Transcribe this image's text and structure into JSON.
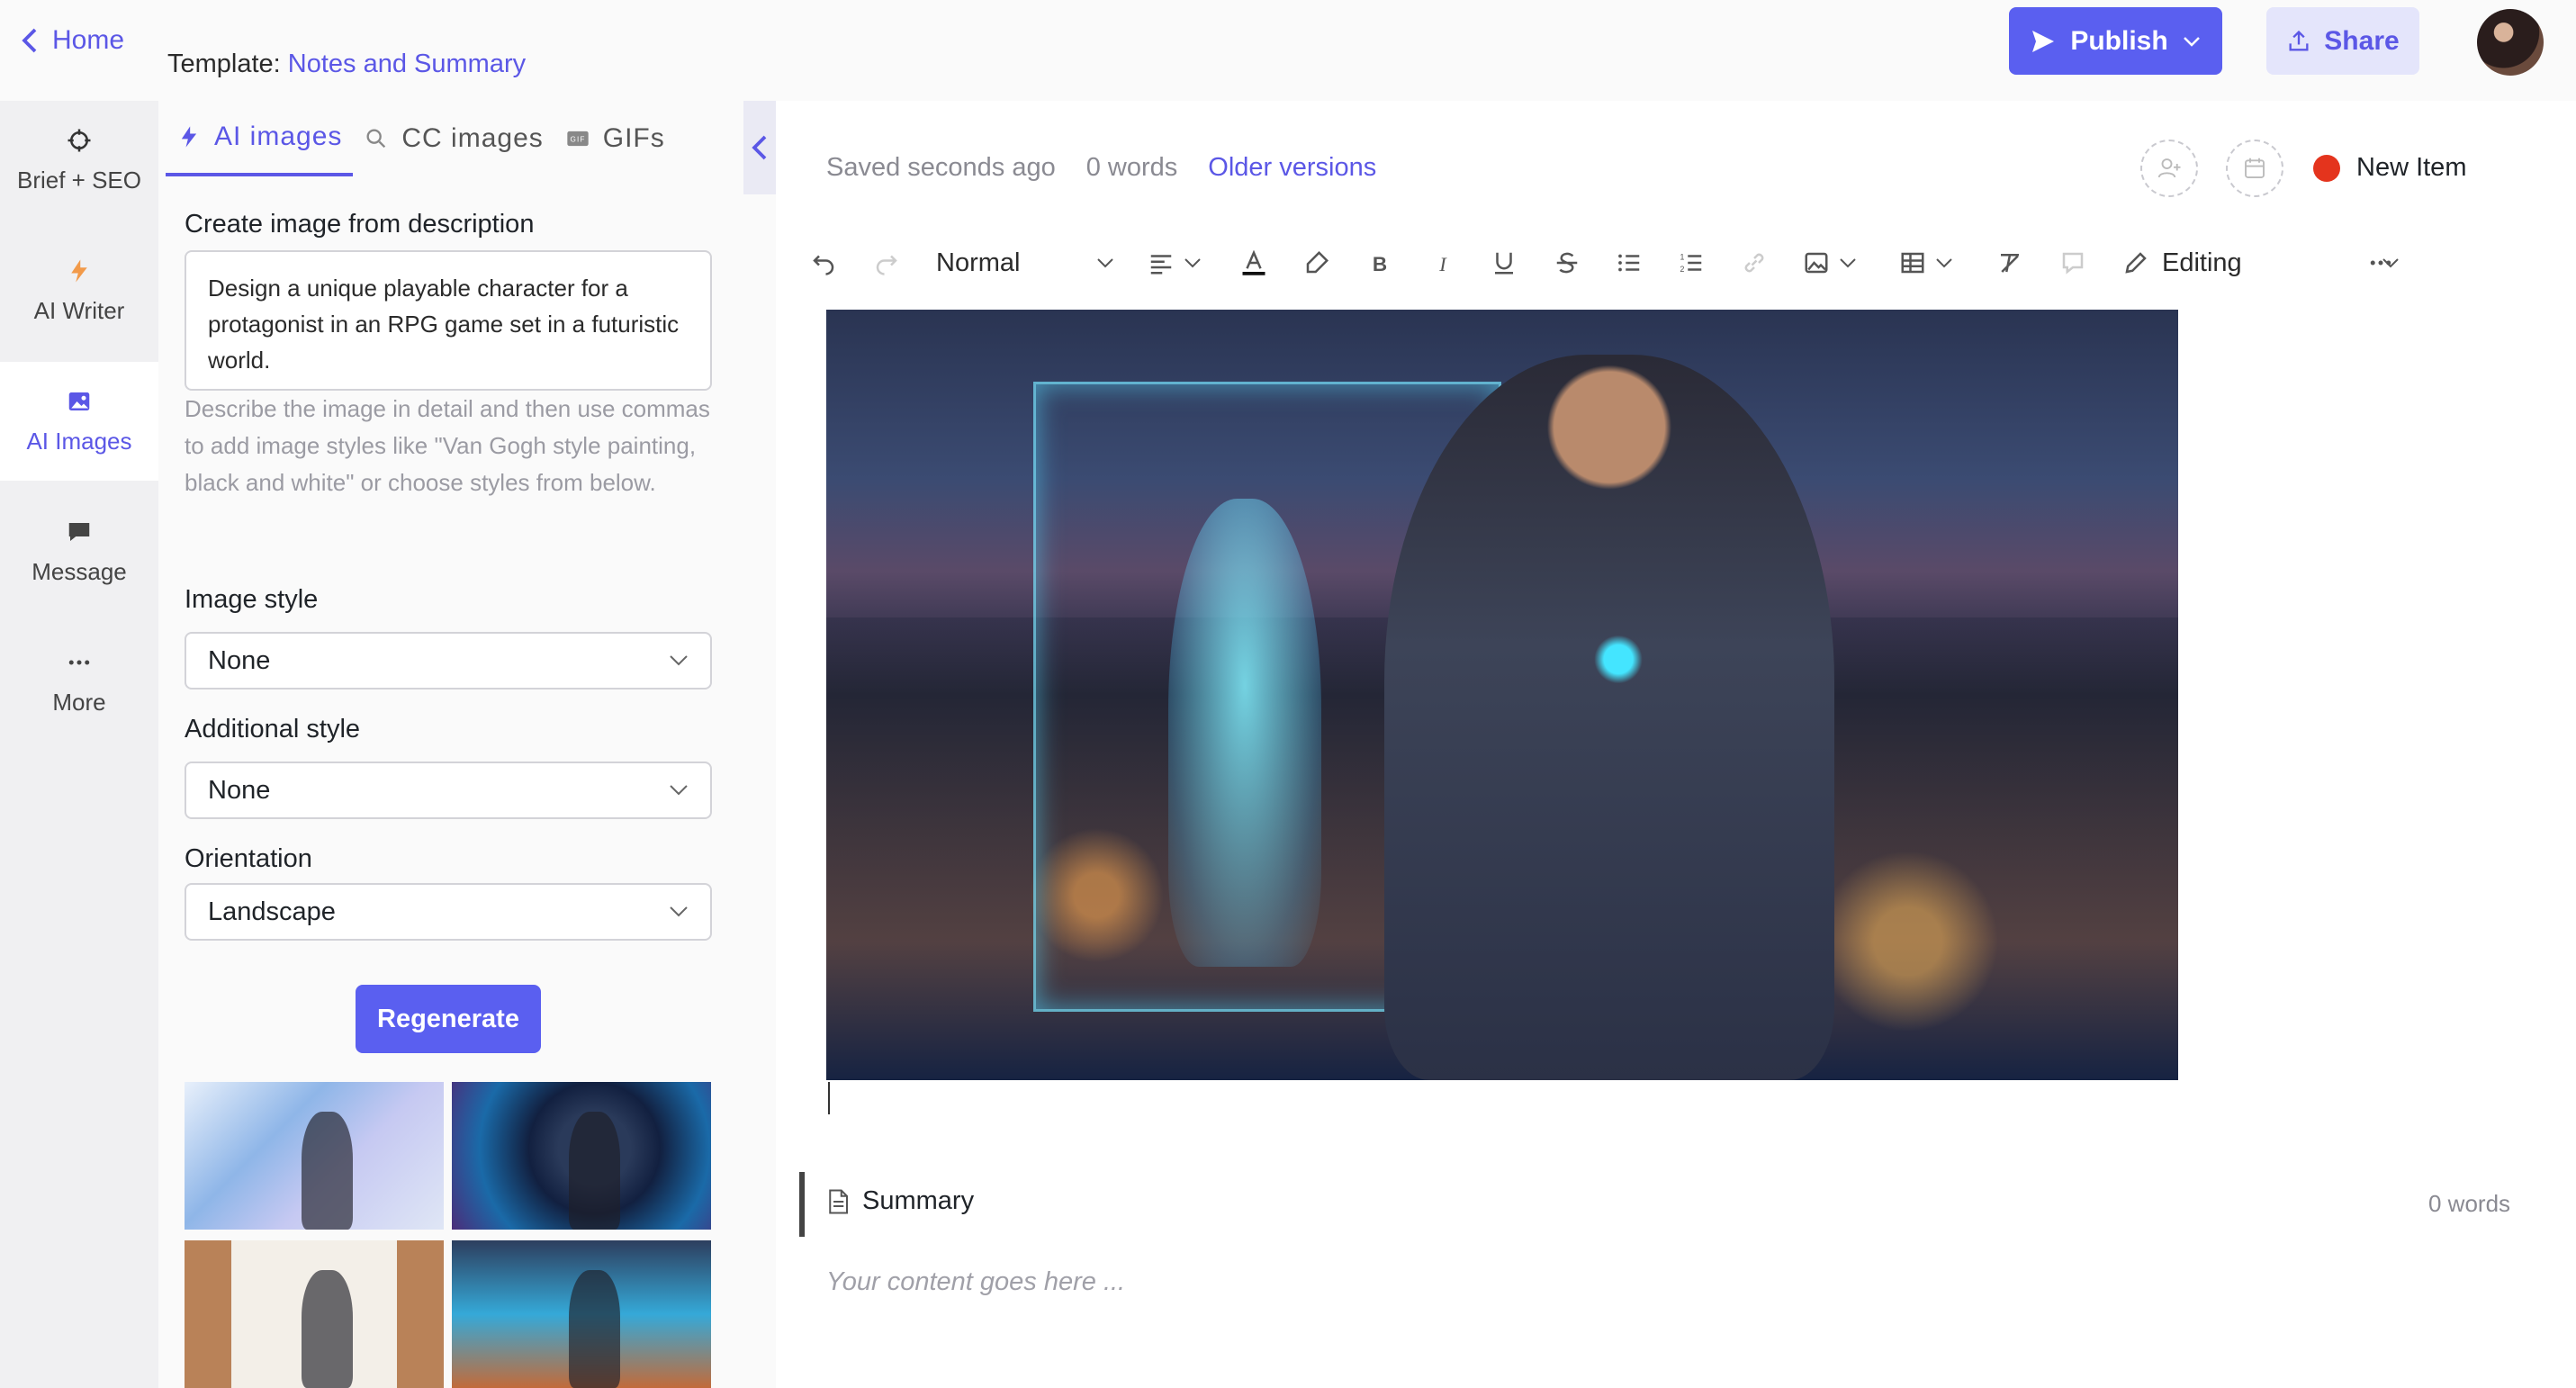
{
  "header": {
    "home_label": "Home",
    "template_prefix": "Template:",
    "template_name": "Notes and Summary",
    "publish_label": "Publish",
    "share_label": "Share"
  },
  "rail": {
    "items": [
      {
        "label": "Brief + SEO",
        "icon": "crosshair-icon"
      },
      {
        "label": "AI Writer",
        "icon": "bolt-icon"
      },
      {
        "label": "AI Images",
        "icon": "image-icon"
      },
      {
        "label": "Message",
        "icon": "chat-icon"
      },
      {
        "label": "More",
        "icon": "more-icon"
      }
    ],
    "active": "AI Images"
  },
  "panel": {
    "tabs": [
      {
        "label": "AI images",
        "icon": "bolt-icon"
      },
      {
        "label": "CC images",
        "icon": "search-icon"
      },
      {
        "label": "GIFs",
        "icon": "gif-icon"
      }
    ],
    "active_tab": "AI images",
    "description_label": "Create image from description",
    "description_value": "Design a unique playable character for a protagonist in an RPG game set in a futuristic world.",
    "hint": "Describe the image in detail and then use commas to add image styles like \"Van Gogh style painting, black and white\" or choose styles from below.",
    "image_style_label": "Image style",
    "image_style_value": "None",
    "additional_style_label": "Additional style",
    "additional_style_value": "None",
    "orientation_label": "Orientation",
    "orientation_value": "Landscape",
    "regenerate_label": "Regenerate"
  },
  "editor": {
    "saved_status": "Saved seconds ago",
    "word_count": "0 words",
    "older_versions": "Older versions",
    "new_item_label": "New Item",
    "toolbar": {
      "paragraph_style": "Normal",
      "mode": "Editing"
    },
    "summary_title": "Summary",
    "summary_word_count": "0 words",
    "content_placeholder": "Your content goes here ..."
  },
  "colors": {
    "accent": "#5a5ff0",
    "status_dot": "#e4341d"
  }
}
